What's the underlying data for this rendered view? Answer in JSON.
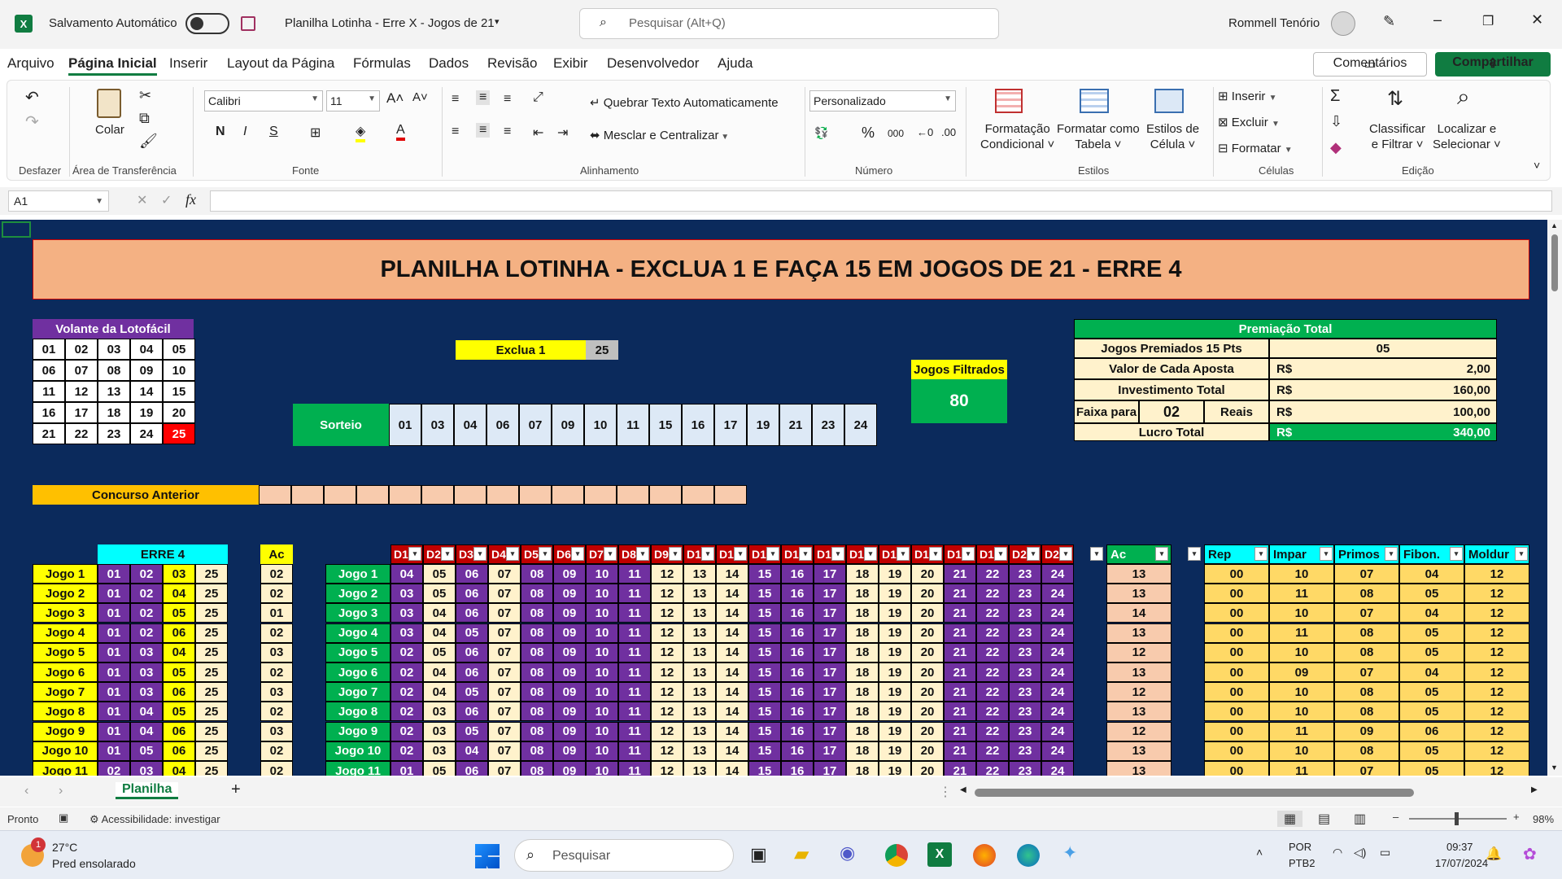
{
  "titlebar": {
    "autosave": "Salvamento Automático",
    "doc_title": "Planilha Lotinha - Erre X - Jogos de 21",
    "search_placeholder": "Pesquisar (Alt+Q)",
    "user": "Rommell Tenório"
  },
  "menu": [
    "Arquivo",
    "Página Inicial",
    "Inserir",
    "Layout da Página",
    "Fórmulas",
    "Dados",
    "Revisão",
    "Exibir",
    "Desenvolvedor",
    "Ajuda"
  ],
  "comments_label": "Comentários",
  "share_label": "Compartilhar",
  "ribbon": {
    "undo_group": "Desfazer",
    "paste": "Colar",
    "clipboard": "Área de Transferência",
    "font_name": "Calibri",
    "font_size": "11",
    "font_group": "Fonte",
    "wrap_text": "Quebrar Texto Automaticamente",
    "merge_center": "Mesclar e Centralizar",
    "alignment_group": "Alinhamento",
    "number_format": "Personalizado",
    "number_group": "Número",
    "cond_format_1": "Formatação",
    "cond_format_2": "Condicional",
    "format_table_1": "Formatar como",
    "format_table_2": "Tabela",
    "cell_styles_1": "Estilos de",
    "cell_styles_2": "Célula",
    "styles_group": "Estilos",
    "insert": "Inserir",
    "delete": "Excluir",
    "format": "Formatar",
    "cells_group": "Células",
    "sort_1": "Classificar",
    "sort_2": "e Filtrar",
    "find_1": "Localizar e",
    "find_2": "Selecionar",
    "editing_group": "Edição"
  },
  "name_box": "A1",
  "sheet": {
    "title": "PLANILHA LOTINHA - EXCLUA 1 E FAÇA 15 EM JOGOS DE 21 - ERRE 4",
    "volante_header": "Volante da Lotofácil",
    "volante": [
      [
        "01",
        "02",
        "03",
        "04",
        "05"
      ],
      [
        "06",
        "07",
        "08",
        "09",
        "10"
      ],
      [
        "11",
        "12",
        "13",
        "14",
        "15"
      ],
      [
        "16",
        "17",
        "18",
        "19",
        "20"
      ],
      [
        "21",
        "22",
        "23",
        "24",
        "25"
      ]
    ],
    "exclua_label": "Exclua 1",
    "exclua_value": "25",
    "sorteio_label": "Sorteio",
    "sorteio": [
      "01",
      "03",
      "04",
      "06",
      "07",
      "09",
      "10",
      "11",
      "15",
      "16",
      "17",
      "19",
      "21",
      "23",
      "24"
    ],
    "jogos_filtrados_label": "Jogos Filtrados",
    "jogos_filtrados_value": "80",
    "premiacao": {
      "header": "Premiação Total",
      "r1_label": "Jogos Premiados 15 Pts",
      "r1_value": "05",
      "r2_label": "Valor de Cada Aposta",
      "r2_cur": "R$",
      "r2_value": "2,00",
      "r3_label": "Investimento Total",
      "r3_cur": "R$",
      "r3_value": "160,00",
      "r4_label": "Faixa para",
      "r4_mid": "02",
      "r4_label2": "Reais",
      "r4_cur": "R$",
      "r4_value": "100,00",
      "r5_label": "Lucro Total",
      "r5_cur": "R$",
      "r5_value": "340,00"
    },
    "concurso_anterior": "Concurso Anterior",
    "erre_header": "ERRE 4",
    "ac_header": "Ac",
    "d_headers": [
      "D1",
      "D2",
      "D3",
      "D4",
      "D5",
      "D6",
      "D7",
      "D8",
      "D9",
      "D1",
      "D1",
      "D1",
      "D1",
      "D1",
      "D1",
      "D1",
      "D1",
      "D1",
      "D1",
      "D2",
      "D2"
    ],
    "ac2_header": "Ac",
    "stat_headers": [
      "Rep",
      "Impar",
      "Primos",
      "Fibon.",
      "Moldur"
    ],
    "games": [
      {
        "name": "Jogo 1",
        "erre": [
          "01",
          "02",
          "03",
          "25"
        ],
        "ac": "02",
        "d": [
          "04",
          "05",
          "06",
          "07",
          "08",
          "09",
          "10",
          "11",
          "12",
          "13",
          "14",
          "15",
          "16",
          "17",
          "18",
          "19",
          "20",
          "21",
          "22",
          "23",
          "24"
        ],
        "ac2": "13",
        "stats": [
          "00",
          "10",
          "07",
          "04",
          "12"
        ]
      },
      {
        "name": "Jogo 2",
        "erre": [
          "01",
          "02",
          "04",
          "25"
        ],
        "ac": "02",
        "d": [
          "03",
          "05",
          "06",
          "07",
          "08",
          "09",
          "10",
          "11",
          "12",
          "13",
          "14",
          "15",
          "16",
          "17",
          "18",
          "19",
          "20",
          "21",
          "22",
          "23",
          "24"
        ],
        "ac2": "13",
        "stats": [
          "00",
          "11",
          "08",
          "05",
          "12"
        ]
      },
      {
        "name": "Jogo 3",
        "erre": [
          "01",
          "02",
          "05",
          "25"
        ],
        "ac": "01",
        "d": [
          "03",
          "04",
          "06",
          "07",
          "08",
          "09",
          "10",
          "11",
          "12",
          "13",
          "14",
          "15",
          "16",
          "17",
          "18",
          "19",
          "20",
          "21",
          "22",
          "23",
          "24"
        ],
        "ac2": "14",
        "stats": [
          "00",
          "10",
          "07",
          "04",
          "12"
        ]
      },
      {
        "name": "Jogo 4",
        "erre": [
          "01",
          "02",
          "06",
          "25"
        ],
        "ac": "02",
        "d": [
          "03",
          "04",
          "05",
          "07",
          "08",
          "09",
          "10",
          "11",
          "12",
          "13",
          "14",
          "15",
          "16",
          "17",
          "18",
          "19",
          "20",
          "21",
          "22",
          "23",
          "24"
        ],
        "ac2": "13",
        "stats": [
          "00",
          "11",
          "08",
          "05",
          "12"
        ]
      },
      {
        "name": "Jogo 5",
        "erre": [
          "01",
          "03",
          "04",
          "25"
        ],
        "ac": "03",
        "d": [
          "02",
          "05",
          "06",
          "07",
          "08",
          "09",
          "10",
          "11",
          "12",
          "13",
          "14",
          "15",
          "16",
          "17",
          "18",
          "19",
          "20",
          "21",
          "22",
          "23",
          "24"
        ],
        "ac2": "12",
        "stats": [
          "00",
          "10",
          "08",
          "05",
          "12"
        ]
      },
      {
        "name": "Jogo 6",
        "erre": [
          "01",
          "03",
          "05",
          "25"
        ],
        "ac": "02",
        "d": [
          "02",
          "04",
          "06",
          "07",
          "08",
          "09",
          "10",
          "11",
          "12",
          "13",
          "14",
          "15",
          "16",
          "17",
          "18",
          "19",
          "20",
          "21",
          "22",
          "23",
          "24"
        ],
        "ac2": "13",
        "stats": [
          "00",
          "09",
          "07",
          "04",
          "12"
        ]
      },
      {
        "name": "Jogo 7",
        "erre": [
          "01",
          "03",
          "06",
          "25"
        ],
        "ac": "03",
        "d": [
          "02",
          "04",
          "05",
          "07",
          "08",
          "09",
          "10",
          "11",
          "12",
          "13",
          "14",
          "15",
          "16",
          "17",
          "18",
          "19",
          "20",
          "21",
          "22",
          "23",
          "24"
        ],
        "ac2": "12",
        "stats": [
          "00",
          "10",
          "08",
          "05",
          "12"
        ]
      },
      {
        "name": "Jogo 8",
        "erre": [
          "01",
          "04",
          "05",
          "25"
        ],
        "ac": "02",
        "d": [
          "02",
          "03",
          "06",
          "07",
          "08",
          "09",
          "10",
          "11",
          "12",
          "13",
          "14",
          "15",
          "16",
          "17",
          "18",
          "19",
          "20",
          "21",
          "22",
          "23",
          "24"
        ],
        "ac2": "13",
        "stats": [
          "00",
          "10",
          "08",
          "05",
          "12"
        ]
      },
      {
        "name": "Jogo 9",
        "erre": [
          "01",
          "04",
          "06",
          "25"
        ],
        "ac": "03",
        "d": [
          "02",
          "03",
          "05",
          "07",
          "08",
          "09",
          "10",
          "11",
          "12",
          "13",
          "14",
          "15",
          "16",
          "17",
          "18",
          "19",
          "20",
          "21",
          "22",
          "23",
          "24"
        ],
        "ac2": "12",
        "stats": [
          "00",
          "11",
          "09",
          "06",
          "12"
        ]
      },
      {
        "name": "Jogo 10",
        "erre": [
          "01",
          "05",
          "06",
          "25"
        ],
        "ac": "02",
        "d": [
          "02",
          "03",
          "04",
          "07",
          "08",
          "09",
          "10",
          "11",
          "12",
          "13",
          "14",
          "15",
          "16",
          "17",
          "18",
          "19",
          "20",
          "21",
          "22",
          "23",
          "24"
        ],
        "ac2": "13",
        "stats": [
          "00",
          "10",
          "08",
          "05",
          "12"
        ]
      },
      {
        "name": "Jogo 11",
        "erre": [
          "02",
          "03",
          "04",
          "25"
        ],
        "ac": "02",
        "d": [
          "01",
          "05",
          "06",
          "07",
          "08",
          "09",
          "10",
          "11",
          "12",
          "13",
          "14",
          "15",
          "16",
          "17",
          "18",
          "19",
          "20",
          "21",
          "22",
          "23",
          "24"
        ],
        "ac2": "13",
        "stats": [
          "00",
          "11",
          "07",
          "05",
          "12"
        ]
      }
    ]
  },
  "sheet_tab": "Planilha",
  "status": {
    "ready": "Pronto",
    "accessibility": "Acessibilidade: investigar",
    "zoom": "98%"
  },
  "taskbar": {
    "temp": "27°C",
    "weather": "Pred ensolarado",
    "search": "Pesquisar",
    "lang1": "POR",
    "lang2": "PTB2",
    "time": "09:37",
    "date": "17/07/2024",
    "badge": "1"
  }
}
